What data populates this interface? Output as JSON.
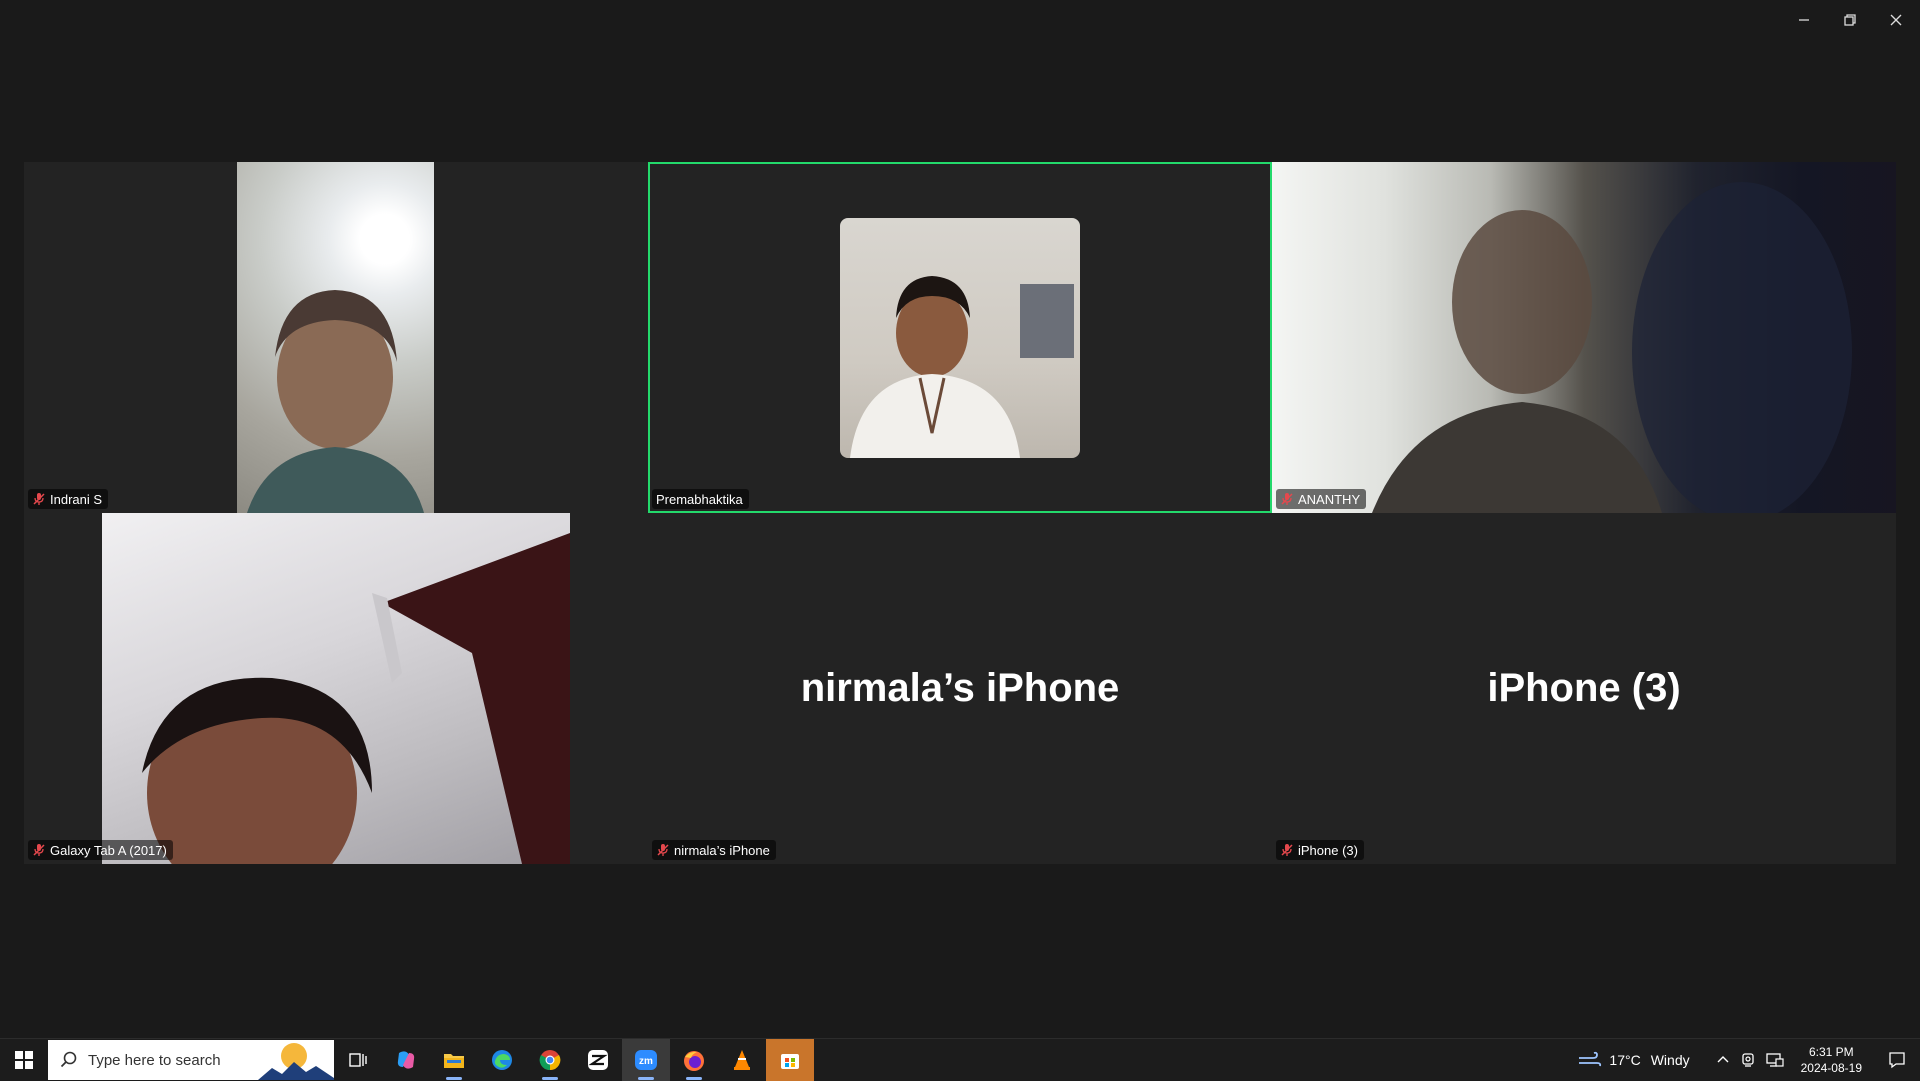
{
  "window": {
    "minimize_icon": "minimize-icon",
    "restore_icon": "restore-icon",
    "close_icon": "close-icon"
  },
  "participants": [
    {
      "name": "Indrani S",
      "muted": true,
      "video": true
    },
    {
      "name": "Premabhaktika",
      "muted": false,
      "video": true,
      "active_speaker": true
    },
    {
      "name": "ANANTHY",
      "muted": true,
      "video": true
    },
    {
      "name": "Galaxy Tab A (2017)",
      "muted": true,
      "video": true
    },
    {
      "name": "nirmala’s iPhone",
      "muted": true,
      "video": false,
      "display_name": "nirmala’s iPhone"
    },
    {
      "name": "iPhone (3)",
      "muted": true,
      "video": false,
      "display_name": "iPhone (3)"
    }
  ],
  "colors": {
    "active_border": "#23d96b",
    "muted_icon": "#e5484d",
    "tile_bg": "#232323",
    "app_bg": "#1a1a1a"
  },
  "taskbar": {
    "search_placeholder": "Type here to search",
    "apps": [
      "task-view-icon",
      "copilot-icon",
      "file-explorer-icon",
      "edge-icon",
      "chrome-icon",
      "capcut-icon",
      "zoom-icon",
      "firefox-icon",
      "vlc-icon",
      "store-icon"
    ],
    "weather": {
      "temp": "17°C",
      "condition": "Windy"
    },
    "clock": {
      "time": "6:31 PM",
      "date": "2024-08-19"
    }
  }
}
